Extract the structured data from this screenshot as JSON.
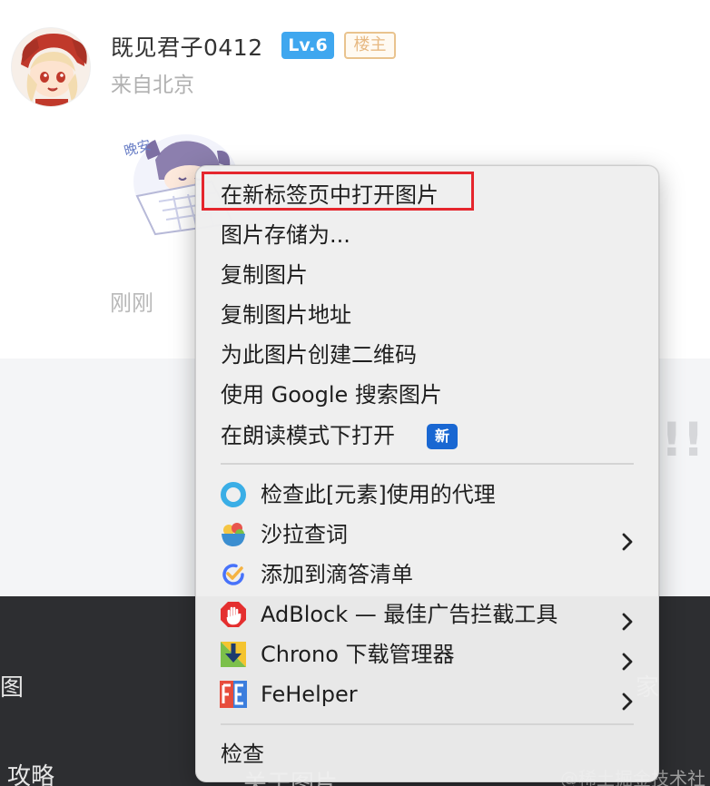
{
  "post": {
    "username": "既见君子0412",
    "level_badge": "Lv.6",
    "owner_badge": "楼主",
    "location": "来自北京",
    "time": "刚刚",
    "sticker_text": "晚安"
  },
  "background": {
    "glyph_right": "!!",
    "text_left": "图",
    "text_strategy": "攻略",
    "text_mid": "关于图片",
    "text_right": "家",
    "watermark": "@稀土掘金技术社区"
  },
  "context_menu": {
    "group1": [
      {
        "label": "在新标签页中打开图片",
        "highlighted": true
      },
      {
        "label": "图片存储为..."
      },
      {
        "label": "复制图片"
      },
      {
        "label": "复制图片地址"
      },
      {
        "label": "为此图片创建二维码"
      },
      {
        "label": "使用 Google 搜索图片"
      },
      {
        "label": "在朗读模式下打开",
        "badge": "新"
      }
    ],
    "group2": [
      {
        "label": "检查此[元素]使用的代理",
        "icon": "proxy-ring-icon",
        "submenu": false
      },
      {
        "label": "沙拉查词",
        "icon": "salad-bowl-icon",
        "submenu": true
      },
      {
        "label": "添加到滴答清单",
        "icon": "ticktick-check-icon",
        "submenu": false
      },
      {
        "label": "AdBlock — 最佳广告拦截工具",
        "icon": "adblock-hand-icon",
        "submenu": true
      },
      {
        "label": "Chrono 下载管理器",
        "icon": "chrono-download-icon",
        "submenu": true
      },
      {
        "label": "FeHelper",
        "icon": "fehelper-icon",
        "submenu": true
      }
    ],
    "group3": [
      {
        "label": "检查"
      }
    ]
  },
  "colors": {
    "highlight_border": "#e5262d",
    "level_badge_bg": "#3fa7ef",
    "owner_badge_border": "#e9c38e",
    "new_badge_bg": "#1967d2"
  }
}
